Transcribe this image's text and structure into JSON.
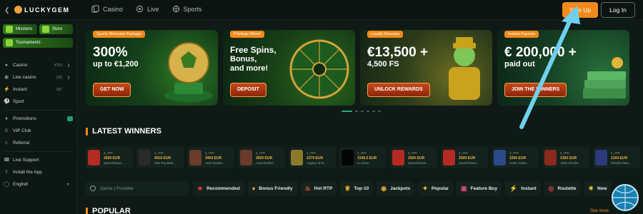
{
  "brand": {
    "logo_text": "LUCKYGEM"
  },
  "topnav": [
    {
      "label": "Casino",
      "icon": "cards-icon"
    },
    {
      "label": "Live",
      "icon": "live-icon"
    },
    {
      "label": "Sports",
      "icon": "ball-icon"
    }
  ],
  "auth": {
    "signup_label": "Sign Up",
    "login_label": "Log In"
  },
  "sidebar": {
    "promo_tiles": [
      {
        "label": "Missions"
      },
      {
        "label": "Store"
      },
      {
        "label": "Tournaments"
      }
    ],
    "items": [
      {
        "label": "Casino",
        "count": "4753",
        "icon": "cards-icon"
      },
      {
        "label": "Live casino",
        "count": "226",
        "icon": "live-icon"
      },
      {
        "label": "Instant",
        "count": "187",
        "icon": "bolt-icon"
      },
      {
        "label": "Sport",
        "icon": "ball-icon"
      },
      {
        "label": "Promotions",
        "icon": "gift-icon"
      },
      {
        "label": "VIP Club",
        "icon": "crown-icon"
      },
      {
        "label": "Referral",
        "icon": "users-icon"
      },
      {
        "label": "Live Support",
        "icon": "headset-icon"
      },
      {
        "label": "Install the App",
        "icon": "download-icon"
      },
      {
        "label": "English",
        "icon": "globe-icon"
      }
    ]
  },
  "banners": [
    {
      "tag": "Sports Welcome Package",
      "line1": "300%",
      "line2": "up to €1,200",
      "cta": "GET NOW"
    },
    {
      "tag": "Privilege Wheel",
      "line1": "Free Spins,",
      "line2": "Bonus,",
      "line3": "and more!",
      "cta": "DEPOSIT"
    },
    {
      "tag": "Loyalty Bonuses",
      "line1": "€13,500 +",
      "line2": "4,500 FS",
      "cta": "UNLOCK REWARDS"
    },
    {
      "tag": "Instant Payouts",
      "line1": "€ 200,000 +",
      "line2": "paid out",
      "cta": "JOIN THE WINNERS"
    }
  ],
  "latest_winners": {
    "title": "LATEST WINNERS",
    "items": [
      {
        "user": "2_•••••",
        "amount": "4300 EUR",
        "game": "Speed Baca...",
        "thumb_color": "#b52a22"
      },
      {
        "user": "2_•••••",
        "amount": "4016 EUR",
        "game": "Star Roulette...",
        "thumb_color": "#2a2a2a"
      },
      {
        "user": "2_•••••",
        "amount": "3400 EUR",
        "game": "Auto-Roulet...",
        "thumb_color": "#6a3a2a"
      },
      {
        "user": "2_•••••",
        "amount": "3600 EUR",
        "game": "Auto-Roulet...",
        "thumb_color": "#6a3a2a"
      },
      {
        "user": "2_•••••",
        "amount": "2270 EUR",
        "game": "Legacy of D...",
        "thumb_color": "#8a7a2a"
      },
      {
        "user": "2_•••••",
        "amount": "3145.6 EUR",
        "game": "Le Zeus",
        "thumb_color": "#050505"
      },
      {
        "user": "2_•••••",
        "amount": "2500 EUR",
        "game": "Speed Baca...",
        "thumb_color": "#b52a22"
      },
      {
        "user": "2_•••••",
        "amount": "2500 EUR",
        "game": "Speed Baca...",
        "thumb_color": "#b52a22"
      },
      {
        "user": "2_•••••",
        "amount": "2200 EUR",
        "game": "Cash Crane...",
        "thumb_color": "#2a4a8a"
      },
      {
        "user": "2_•••••",
        "amount": "2183 EUR",
        "game": "1626 Hit Slot",
        "thumb_color": "#8a2a1a"
      },
      {
        "user": "2_•••••",
        "amount": "2104 EUR",
        "game": "Shaolin Mas...",
        "thumb_color": "#2a3a7a"
      }
    ]
  },
  "search": {
    "placeholder": "Game | Provider"
  },
  "filters": [
    {
      "label": "Recommended",
      "icon": "star-icon"
    },
    {
      "label": "Bonus Friendly",
      "icon": "gift-icon"
    },
    {
      "label": "Hot RTP",
      "icon": "flame-icon"
    },
    {
      "label": "Top-10",
      "icon": "trophy-icon"
    },
    {
      "label": "Jackpots",
      "icon": "bag-icon"
    },
    {
      "label": "Popular",
      "icon": "medal-icon"
    },
    {
      "label": "Feature Buy",
      "icon": "ticket-icon"
    },
    {
      "label": "Instant",
      "icon": "bolt-icon"
    },
    {
      "label": "Roulette",
      "icon": "roulette-icon"
    },
    {
      "label": "New",
      "icon": "new-icon"
    }
  ],
  "popular": {
    "title": "POPULAR",
    "see_more": "See more"
  },
  "colors": {
    "accent": "#f28a1a",
    "background": "#0f1a16",
    "active_dot": "#2fae76"
  }
}
